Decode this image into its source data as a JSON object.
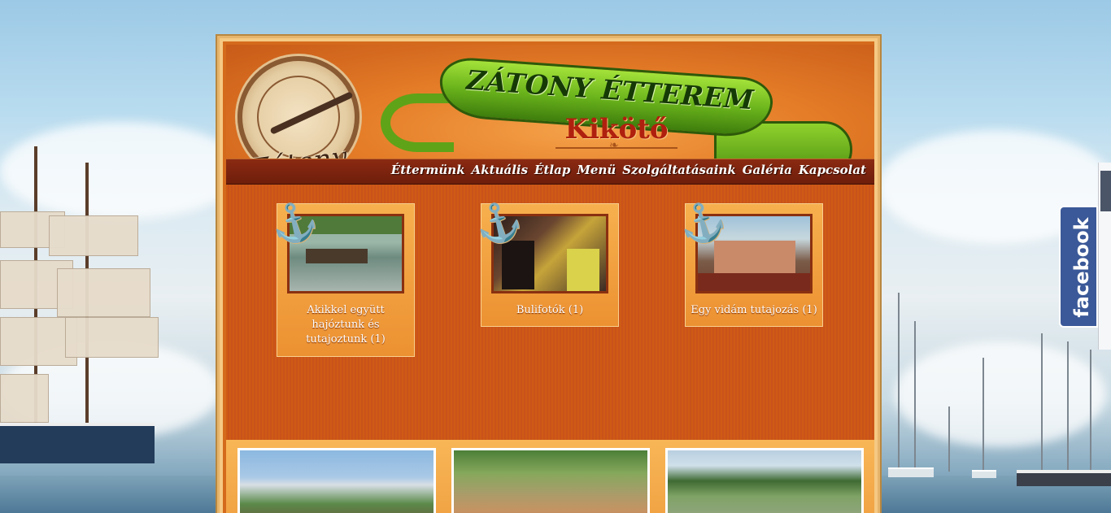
{
  "site": {
    "title": "ZÁTONY ÉTTEREM",
    "subtitle": "Kikötő",
    "logo_text": "Zátony"
  },
  "nav": {
    "items": [
      {
        "label": "Éttermünk"
      },
      {
        "label": "Aktuális"
      },
      {
        "label": "Étlap"
      },
      {
        "label": "Menü"
      },
      {
        "label": "Szolgáltatásaink"
      },
      {
        "label": "Galéria"
      },
      {
        "label": "Kapcsolat"
      }
    ]
  },
  "albums": [
    {
      "caption": "Akikkel együtt hajóztunk és tutajoztunk (1)"
    },
    {
      "caption": "Bulifotók (1)"
    },
    {
      "caption": "Egy vidám tutajozás (1)"
    }
  ],
  "social": {
    "facebook_label": "facebook"
  },
  "colors": {
    "frame": "#d46a1c",
    "nav_bar": "#7a240e",
    "banner_green": "#6cb51c",
    "subtitle_red": "#b0200e",
    "facebook_blue": "#3b5998"
  }
}
